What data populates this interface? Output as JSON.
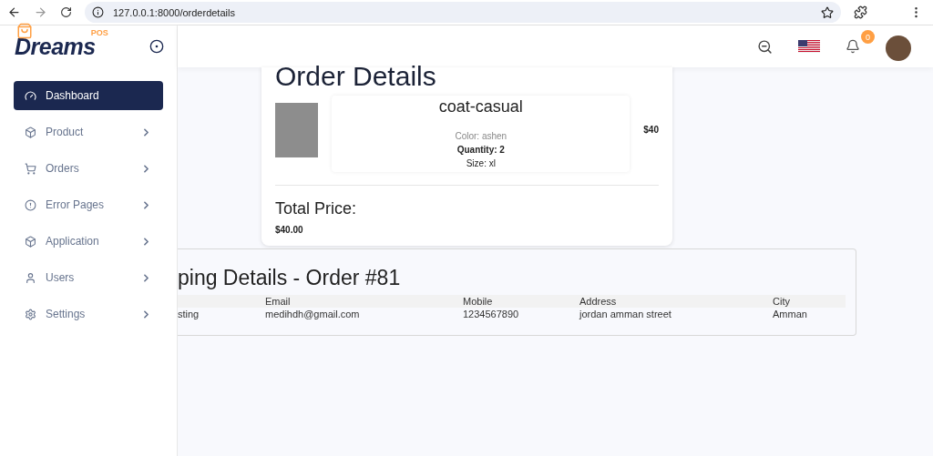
{
  "browser": {
    "url": "127.0.0.1:8000/orderdetails"
  },
  "sidebar": {
    "logo": "Dreams",
    "logo_badge": "POS",
    "items": [
      {
        "label": "Dashboard",
        "kind": "gauge",
        "selected": true,
        "has_submenu": false
      },
      {
        "label": "Product",
        "kind": "box",
        "selected": false,
        "has_submenu": true
      },
      {
        "label": "Orders",
        "kind": "cart",
        "selected": false,
        "has_submenu": true
      },
      {
        "label": "Error Pages",
        "kind": "alert",
        "selected": false,
        "has_submenu": true
      },
      {
        "label": "Application",
        "kind": "box",
        "selected": false,
        "has_submenu": true
      },
      {
        "label": "Users",
        "kind": "user",
        "selected": false,
        "has_submenu": true
      },
      {
        "label": "Settings",
        "kind": "gear",
        "selected": false,
        "has_submenu": true
      }
    ]
  },
  "header": {
    "notification_count": "0"
  },
  "order": {
    "title": "Order Details",
    "items": [
      {
        "name": "coat-casual",
        "color_label": "Color: ashen",
        "quantity": "Quantity: 2",
        "size": "Size: xl",
        "price": "$40"
      }
    ],
    "total_label": "Total Price:",
    "total": "$40.00"
  },
  "shipping": {
    "title": "ping Details - Order #81",
    "columns": [
      "",
      "Email",
      "Mobile",
      "Address",
      "City"
    ],
    "rows": [
      [
        "sting",
        "medihdh@gmail.com",
        "1234567890",
        "jordan amman street",
        "Amman"
      ]
    ]
  }
}
